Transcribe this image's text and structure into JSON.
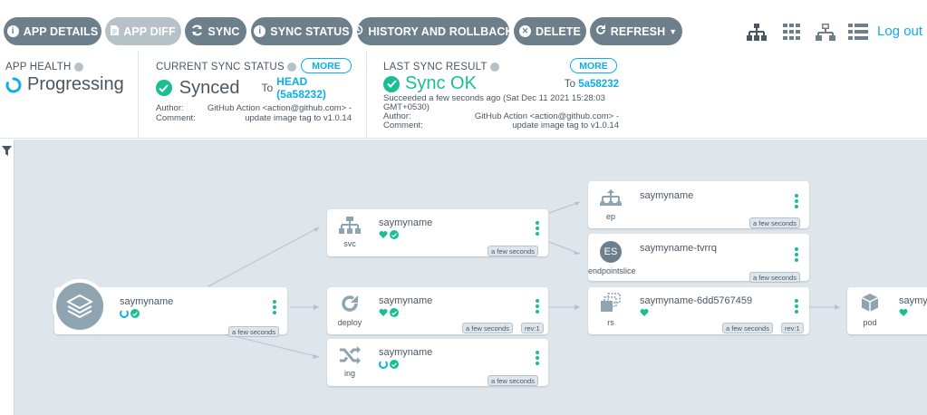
{
  "toolbar": {
    "app_details": "APP DETAILS",
    "app_diff": "APP DIFF",
    "sync": "SYNC",
    "sync_status": "SYNC STATUS",
    "history": "HISTORY AND ROLLBACK",
    "delete": "DELETE",
    "refresh": "REFRESH",
    "logout": "Log out"
  },
  "status": {
    "app_health_label": "APP HEALTH",
    "app_health_value": "Progressing",
    "current_sync_label": "CURRENT SYNC STATUS",
    "more": "MORE",
    "current_sync_value": "Synced",
    "to_head_prefix": "To",
    "to_head_value": "HEAD (5a58232)",
    "author_label": "Author:",
    "author_value": "GitHub Action <action@github.com> -",
    "comment_label": "Comment:",
    "comment_value": "update image tag to v1.0.14",
    "last_sync_label": "LAST SYNC RESULT",
    "last_sync_value": "Sync OK",
    "to_prefix": "To",
    "to_value": "5a58232",
    "succeeded_line1": "Succeeded a few seconds ago (Sat Dec 11 2021 15:28:03",
    "succeeded_line2": "GMT+0530)",
    "last_author_label": "Author:",
    "last_author_value": "GitHub Action <action@github.com> -",
    "last_comment_label": "Comment:",
    "last_comment_value": "update image tag to v1.0.14"
  },
  "graph": {
    "app": {
      "name": "saymyname",
      "age": "a few seconds"
    },
    "svc": {
      "kind": "svc",
      "name": "saymyname",
      "age": "a few seconds"
    },
    "deploy": {
      "kind": "deploy",
      "name": "saymyname",
      "age": "a few seconds",
      "rev": "rev:1"
    },
    "ing": {
      "kind": "ing",
      "name": "saymyname",
      "age": "a few seconds"
    },
    "ep": {
      "kind": "ep",
      "name": "saymyname",
      "age": "a few seconds"
    },
    "endpointslice": {
      "kind": "endpointslice",
      "badge": "ES",
      "name": "saymyname-tvrrq",
      "age": "a few seconds"
    },
    "rs": {
      "kind": "rs",
      "name": "saymyname-6dd5767459",
      "age": "a few seconds",
      "rev": "rev:1"
    },
    "pod": {
      "kind": "pod",
      "name": "saymy"
    }
  },
  "colors": {
    "accent": "#0dadea",
    "healthy": "#18be94",
    "toolbar_btn": "#6d7f8b",
    "canvas": "#dee6eb"
  }
}
